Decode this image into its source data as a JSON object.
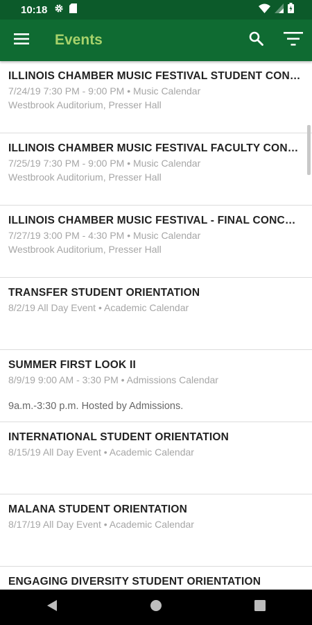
{
  "status_bar": {
    "time": "10:18"
  },
  "app_bar": {
    "title": "Events"
  },
  "events": [
    {
      "title": "ILLINOIS CHAMBER MUSIC FESTIVAL STUDENT CONCERT",
      "meta": "7/24/19 7:30 PM - 9:00 PM • Music Calendar",
      "location": "Westbrook Auditorium, Presser Hall"
    },
    {
      "title": "ILLINOIS CHAMBER MUSIC FESTIVAL FACULTY CONCERT",
      "meta": "7/25/19 7:30 PM - 9:00 PM • Music Calendar",
      "location": "Westbrook Auditorium, Presser Hall"
    },
    {
      "title": "ILLINOIS CHAMBER MUSIC FESTIVAL - FINAL CONCERT",
      "meta": "7/27/19 3:00 PM - 4:30 PM • Music Calendar",
      "location": "Westbrook Auditorium, Presser Hall"
    },
    {
      "title": "TRANSFER STUDENT ORIENTATION",
      "meta": "8/2/19 All Day Event • Academic Calendar"
    },
    {
      "title": "SUMMER FIRST LOOK II",
      "meta": "8/9/19 9:00 AM - 3:30 PM • Admissions Calendar",
      "description": "9a.m.-3:30 p.m. Hosted by Admissions."
    },
    {
      "title": "INTERNATIONAL STUDENT ORIENTATION",
      "meta": "8/15/19 All Day Event • Academic Calendar"
    },
    {
      "title": "MALANA STUDENT ORIENTATION",
      "meta": "8/17/19 All Day Event • Academic Calendar"
    },
    {
      "title": "ENGAGING DIVERSITY STUDENT ORIENTATION"
    }
  ],
  "colors": {
    "status_bar": "#0c5a2a",
    "app_bar": "#0f6b32",
    "title_accent": "#a7d26b"
  },
  "icons": {
    "menu": "hamburger-icon",
    "search": "search-icon",
    "filter": "filter-icon"
  }
}
